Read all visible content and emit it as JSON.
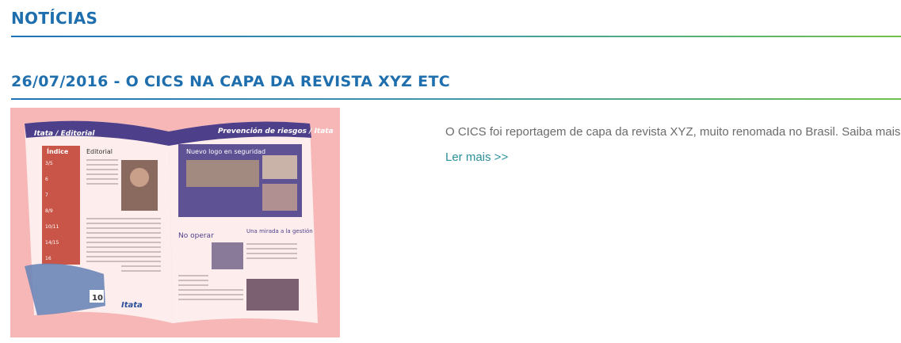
{
  "section": {
    "title": "NOTÍCIAS"
  },
  "news": {
    "headline": "26/07/2016 - O CICS NA CAPA DA REVISTA XYZ ETC",
    "summary": "O CICS foi reportagem de capa da revista XYZ, muito renomada no Brasil. Saiba mais",
    "read_more": "Ler mais >>",
    "thumbnail": {
      "left_page_header": "Itata / Editorial",
      "right_page_header": "Prevención de riesgos / Itata",
      "index_title": "Índice",
      "editorial_title": "Editorial",
      "article_title_1": "Nuevo logo en seguridad",
      "article_title_2": "No operar",
      "article_title_3": "Una mirada a la gestión",
      "page_number": "10",
      "brand_logo": "Itata",
      "index_numbers": [
        "3/5",
        "6",
        "7",
        "8/9",
        "10/11",
        "14/15",
        "16"
      ]
    }
  },
  "colors": {
    "heading": "#1f6fae",
    "body_text": "#6b6b6b",
    "link": "#2a8f9a",
    "rule_start": "#1e73b8",
    "rule_end": "#6fc24a",
    "overlay": "#f7b7b7"
  }
}
